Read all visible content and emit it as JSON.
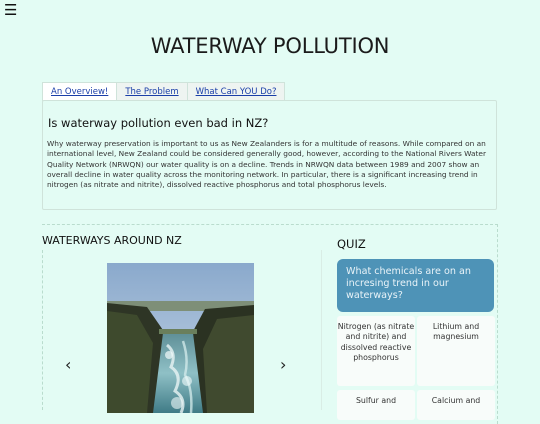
{
  "header": {
    "menu_icon": "☰",
    "title": "WATERWAY POLLUTION"
  },
  "tabs": [
    {
      "label": "An Overview!"
    },
    {
      "label": "The Problem"
    },
    {
      "label": "What Can YOU Do?"
    }
  ],
  "overview": {
    "heading": "Is waterway pollution even bad in NZ?",
    "body": "Why waterway preservation is important to us as New Zealanders is for a multitude of reasons. While compared on an international level, New Zealand could be considered generally good, however, according to the National Rivers Water Quality Network (NRWQN) our water quality is on a decline. Trends in NRWQN data between 1989 and 2007 show an overall decline in water quality across the monitoring network. In particular, there is a significant increasing trend in nitrogen (as nitrate and nitrite), dissolved reactive phosphorus and total phosphorus levels."
  },
  "waterways": {
    "heading": "WATERWAYS AROUND NZ",
    "prev_icon": "‹",
    "next_icon": "›"
  },
  "quiz": {
    "heading": "QUIZ",
    "question": "What chemicals are on an incresing trend in our waterways?",
    "answers": [
      "Nitrogen (as nitrate and nitrite) and dissolved reactive phosphorus",
      "Lithium and magnesium",
      "Sulfur and",
      "Calcium and"
    ]
  },
  "colors": {
    "background": "#e3fcf4",
    "quiz_question_bg": "#4e93b7",
    "tab_link": "#1a3ea8"
  }
}
